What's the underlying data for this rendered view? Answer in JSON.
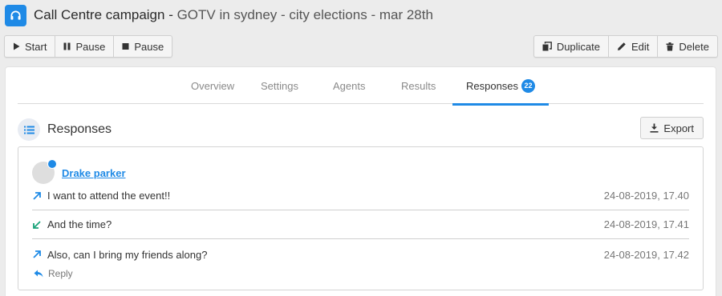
{
  "header": {
    "title_strong": "Call Centre campaign -",
    "title_rest": " GOTV in sydney - city elections - mar 28th"
  },
  "toolbar": {
    "start_label": "Start",
    "pause_label": "Pause",
    "stop_label": "Pause",
    "duplicate_label": "Duplicate",
    "edit_label": "Edit",
    "delete_label": "Delete"
  },
  "tabs": [
    {
      "label": "Overview"
    },
    {
      "label": "Settings"
    },
    {
      "label": "Agents"
    },
    {
      "label": "Results"
    },
    {
      "label": "Responses",
      "badge": "22",
      "active": true
    }
  ],
  "section": {
    "title": "Responses",
    "export_label": "Export"
  },
  "conversation": {
    "contact_name": "Drake parker",
    "messages": [
      {
        "direction": "outgoing",
        "text": "I want to attend the event!!",
        "time": "24-08-2019, 17.40"
      },
      {
        "direction": "incoming",
        "text": "And the time?",
        "time": "24-08-2019, 17.41"
      },
      {
        "direction": "outgoing",
        "text": "Also, can I bring my friends along?",
        "time": "24-08-2019, 17.42"
      }
    ],
    "reply_label": "Reply"
  },
  "colors": {
    "accent": "#1f8ae6",
    "incoming": "#1aa37a"
  }
}
